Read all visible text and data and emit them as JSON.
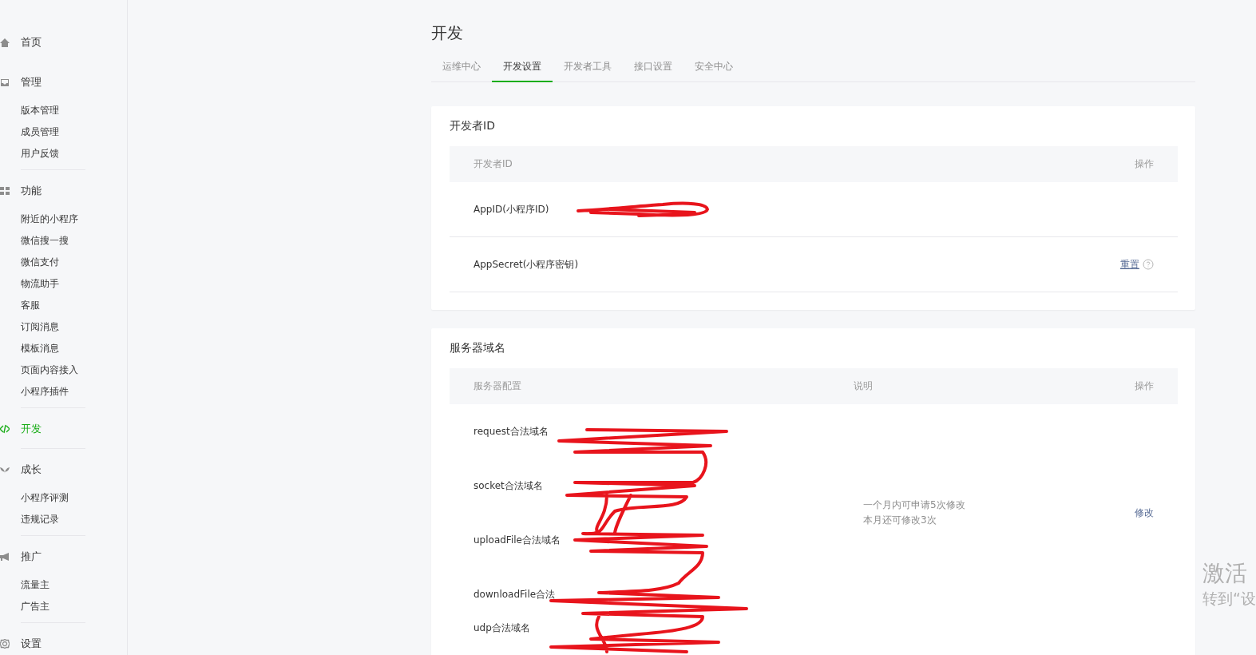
{
  "sidebar": {
    "sections": [
      {
        "label": "首页",
        "selected": false
      },
      {
        "label": "管理",
        "selected": false,
        "items": [
          {
            "label": "版本管理",
            "selected": false
          },
          {
            "label": "成员管理",
            "selected": false
          },
          {
            "label": "用户反馈",
            "selected": false
          }
        ]
      },
      {
        "label": "功能",
        "selected": false,
        "items": [
          {
            "label": "附近的小程序",
            "selected": false
          },
          {
            "label": "微信搜一搜",
            "selected": false
          },
          {
            "label": "微信支付",
            "selected": false
          },
          {
            "label": "物流助手",
            "selected": false
          },
          {
            "label": "客服",
            "selected": false
          },
          {
            "label": "订阅消息",
            "selected": false
          },
          {
            "label": "模板消息",
            "selected": false
          },
          {
            "label": "页面内容接入",
            "selected": false
          },
          {
            "label": "小程序插件",
            "selected": false
          }
        ]
      },
      {
        "label": "开发",
        "selected": true
      },
      {
        "label": "成长",
        "selected": false,
        "items": [
          {
            "label": "小程序评测",
            "selected": false
          },
          {
            "label": "违规记录",
            "selected": false
          }
        ]
      },
      {
        "label": "推广",
        "selected": false,
        "items": [
          {
            "label": "流量主",
            "selected": false
          },
          {
            "label": "广告主",
            "selected": false
          }
        ]
      },
      {
        "label": "设置",
        "selected": false
      }
    ]
  },
  "page_title": "开发",
  "tabs": [
    {
      "label": "运维中心",
      "selected": false
    },
    {
      "label": "开发设置",
      "selected": true
    },
    {
      "label": "开发者工具",
      "selected": false
    },
    {
      "label": "接口设置",
      "selected": false
    },
    {
      "label": "安全中心",
      "selected": false
    }
  ],
  "developer_id": {
    "title": "开发者ID",
    "columns": [
      "开发者ID",
      "操作"
    ],
    "rows": [
      {
        "label": "AppID(小程序ID)"
      },
      {
        "label": "AppSecret(小程序密钥)",
        "action": "重置"
      }
    ]
  },
  "server_domains": {
    "title": "服务器域名",
    "columns": [
      "服务器配置",
      "说明",
      "操作"
    ],
    "rows": [
      {
        "label": "request合法域名"
      },
      {
        "label": "socket合法域名"
      },
      {
        "label": "uploadFile合法域名"
      },
      {
        "label": "downloadFile合法"
      },
      {
        "label": "udp合法域名"
      }
    ],
    "note": [
      "一个月内可申请5次修改",
      "本月还可修改3次"
    ],
    "action": "修改"
  },
  "activation_notice": [
    "激活",
    "转到“设"
  ]
}
